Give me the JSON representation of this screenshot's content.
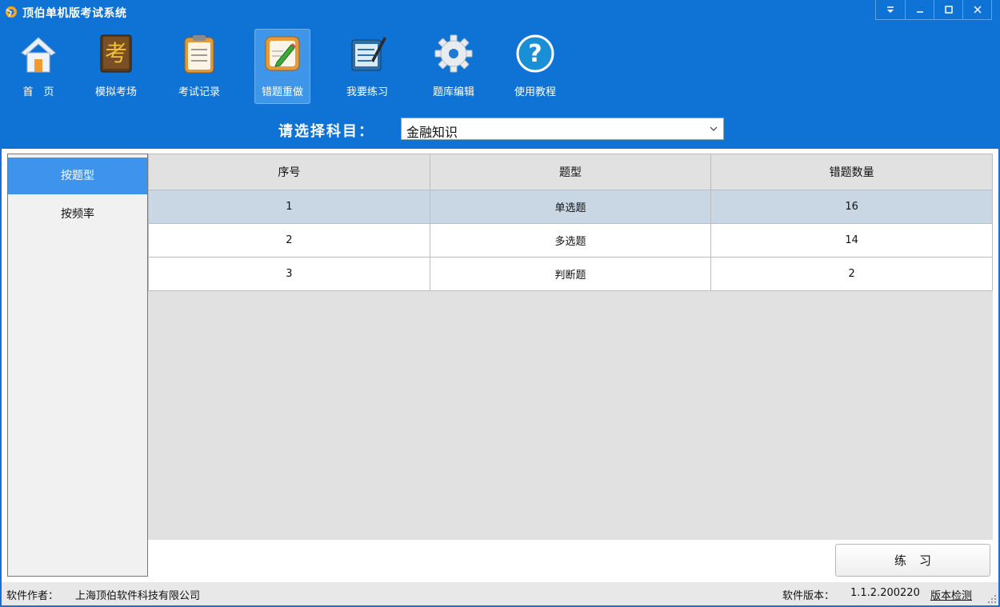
{
  "window": {
    "title": "顶伯单机版考试系统"
  },
  "toolbar": {
    "items": [
      {
        "label": "首　页",
        "icon": "home-icon"
      },
      {
        "label": "模拟考场",
        "icon": "exam-book-icon"
      },
      {
        "label": "考试记录",
        "icon": "clipboard-icon"
      },
      {
        "label": "错题重做",
        "icon": "edit-paper-icon"
      },
      {
        "label": "我要练习",
        "icon": "notepad-pen-icon"
      },
      {
        "label": "题库编辑",
        "icon": "gear-icon"
      },
      {
        "label": "使用教程",
        "icon": "help-icon"
      }
    ],
    "active_index": 3
  },
  "subject": {
    "label": "请选择科目：",
    "selected": "金融知识"
  },
  "sidebar": {
    "items": [
      {
        "label": "按题型"
      },
      {
        "label": "按频率"
      }
    ]
  },
  "table": {
    "headers": [
      "序号",
      "题型",
      "错题数量"
    ],
    "rows": [
      [
        "1",
        "单选题",
        "16"
      ],
      [
        "2",
        "多选题",
        "14"
      ],
      [
        "3",
        "判断题",
        "2"
      ]
    ]
  },
  "practice_button": "练习",
  "status": {
    "author_label": "软件作者：",
    "author": "上海顶伯软件科技有限公司",
    "version_label": "软件版本：",
    "version": "1.1.2.200220",
    "check_link": "版本检测"
  },
  "colors": {
    "titlebar": "#0f73d6",
    "active_tab": "#3e94ec",
    "selected_row": "#c9d6e3"
  }
}
